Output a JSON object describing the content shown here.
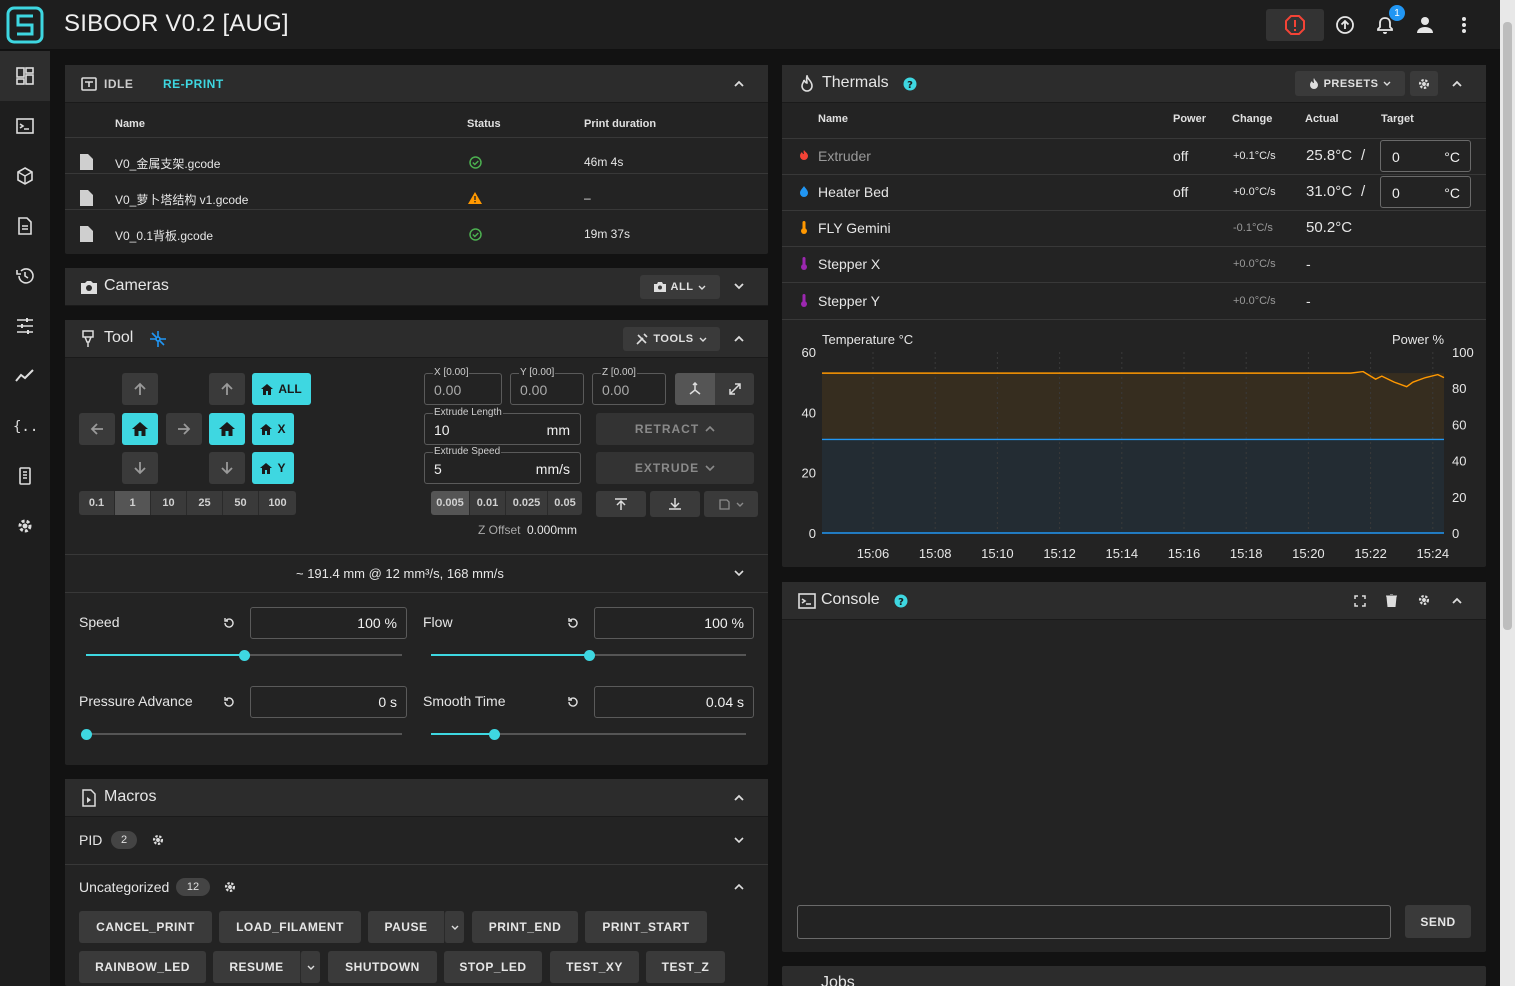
{
  "app": {
    "title": "SIBOOR V0.2 [AUG]",
    "notification_count": "1"
  },
  "sidebar": [
    "dashboard-icon",
    "console-icon",
    "heightmap-icon",
    "files-icon",
    "history-icon",
    "tune-icon",
    "graph-icon",
    "config-icon",
    "system-icon",
    "settings-icon"
  ],
  "status_card": {
    "state": "IDLE",
    "reprint_label": "RE-PRINT",
    "columns": [
      "Name",
      "Status",
      "Print duration"
    ],
    "rows": [
      {
        "name": "V0_金属支架.gcode",
        "status": "completed",
        "duration": "46m 4s"
      },
      {
        "name": "V0_萝卜塔结构 v1.gcode",
        "status": "warning",
        "duration": "–"
      },
      {
        "name": "V0_0.1背板.gcode",
        "status": "completed",
        "duration": "19m 37s"
      }
    ]
  },
  "cameras": {
    "title": "Cameras",
    "filter_label": "ALL"
  },
  "tool": {
    "title": "Tool",
    "tools_label": "TOOLS",
    "home_all": "ALL",
    "home_x": "X",
    "home_y": "Y",
    "xy_steps": [
      "0.1",
      "1",
      "10",
      "25",
      "50",
      "100"
    ],
    "xy_selected": "1",
    "pos": {
      "x_label": "X [0.00]",
      "x_value": "0.00",
      "y_label": "Y [0.00]",
      "y_value": "0.00",
      "z_label": "Z [0.00]",
      "z_value": "0.00"
    },
    "extrude_length_label": "Extrude Length",
    "extrude_length": "10",
    "extrude_length_unit": "mm",
    "extrude_speed_label": "Extrude Speed",
    "extrude_speed": "5",
    "extrude_speed_unit": "mm/s",
    "retract_label": "RETRACT",
    "extrude_label": "EXTRUDE",
    "z_steps": [
      "0.005",
      "0.01",
      "0.025",
      "0.05"
    ],
    "z_selected": "0.005",
    "z_offset_label": "Z Offset",
    "z_offset_value": "0.000mm",
    "summary": "~ 191.4 mm @ 12 mm³/s, 168 mm/s",
    "speed_label": "Speed",
    "speed_value": "100 %",
    "speed_fraction": 0.5,
    "flow_label": "Flow",
    "flow_value": "100 %",
    "flow_fraction": 0.5,
    "pa_label": "Pressure Advance",
    "pa_value": "0 s",
    "pa_fraction": 0.0,
    "smooth_label": "Smooth Time",
    "smooth_value": "0.04 s",
    "smooth_fraction": 0.2
  },
  "macros": {
    "title": "Macros",
    "groups": [
      {
        "name": "PID",
        "count": "2"
      },
      {
        "name": "Uncategorized",
        "count": "12"
      }
    ],
    "buttons": [
      "CANCEL_PRINT",
      "LOAD_FILAMENT",
      "PAUSE",
      "PRINT_END",
      "PRINT_START",
      "RAINBOW_LED",
      "RESUME",
      "SHUTDOWN",
      "STOP_LED",
      "TEST_XY",
      "TEST_Z"
    ]
  },
  "thermals": {
    "title": "Thermals",
    "presets_label": "PRESETS",
    "columns": [
      "Name",
      "Power",
      "Change",
      "Actual",
      "Target"
    ],
    "rows": [
      {
        "name": "Extruder",
        "power": "off",
        "change": "+0.1°C/s",
        "actual": "25.8°C",
        "target": "0",
        "unit": "°C",
        "color": "#f44336"
      },
      {
        "name": "Heater Bed",
        "power": "off",
        "change": "+0.0°C/s",
        "actual": "31.0°C",
        "target": "0",
        "unit": "°C",
        "color": "#2196f3"
      },
      {
        "name": "FLY Gemini",
        "power": "",
        "change": "-0.1°C/s",
        "actual": "50.2°C",
        "target": "",
        "unit": "",
        "color": "#ff9800"
      },
      {
        "name": "Stepper X",
        "power": "",
        "change": "+0.0°C/s",
        "actual": "-",
        "target": "",
        "unit": "",
        "color": "#9c27b0"
      },
      {
        "name": "Stepper Y",
        "power": "",
        "change": "+0.0°C/s",
        "actual": "-",
        "target": "",
        "unit": "",
        "color": "#9c27b0"
      }
    ]
  },
  "chart_data": {
    "type": "line",
    "ylabel": "Temperature °C",
    "y2label": "Power %",
    "ylim": [
      0,
      60
    ],
    "y2lim": [
      0,
      100
    ],
    "yticks": [
      "60",
      "40",
      "20",
      "0"
    ],
    "y2ticks": [
      "100",
      "80",
      "60",
      "40",
      "20",
      "0"
    ],
    "xticks": [
      "15:06",
      "15:08",
      "15:10",
      "15:12",
      "15:14",
      "15:16",
      "15:18",
      "15:20",
      "15:22",
      "15:24"
    ],
    "series": [
      {
        "color": "#ff9800",
        "x": [
          0,
          0.1,
          0.2,
          0.3,
          0.4,
          0.5,
          0.6,
          0.7,
          0.8,
          0.85,
          0.87,
          0.89,
          0.9,
          0.92,
          0.94,
          0.95,
          0.97,
          0.99,
          1.0
        ],
        "values": [
          53,
          53,
          53,
          53,
          53,
          53,
          53,
          53,
          53,
          53,
          53.5,
          51,
          52,
          50,
          48.5,
          50,
          51.5,
          52.5,
          51.5
        ]
      },
      {
        "color": "#2196f3",
        "x": [
          0,
          1
        ],
        "values": [
          31,
          31
        ]
      },
      {
        "color": "#2196f3",
        "x": [
          0,
          1
        ],
        "values": [
          0,
          0
        ]
      }
    ]
  },
  "console": {
    "title": "Console",
    "send_label": "SEND",
    "input_value": ""
  },
  "jobs": {
    "title": "Jobs"
  },
  "colors": {
    "accent": "#3ed7e1",
    "success": "#4caf50",
    "warning": "#ff9800",
    "estop": "#f44336"
  }
}
